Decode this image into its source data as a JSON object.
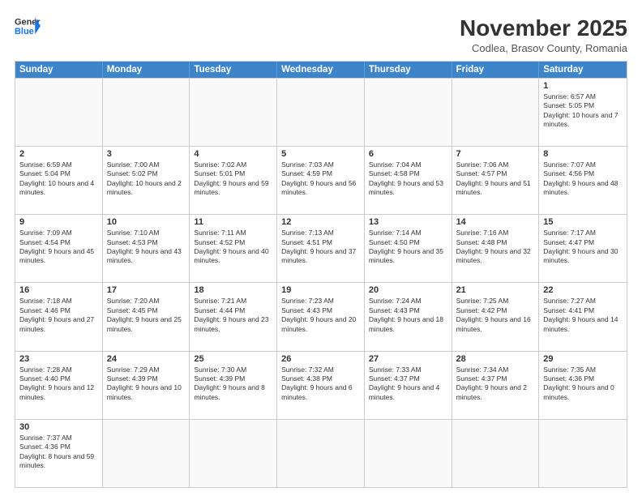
{
  "header": {
    "logo_general": "General",
    "logo_blue": "Blue",
    "month_title": "November 2025",
    "subtitle": "Codlea, Brasov County, Romania"
  },
  "days_of_week": [
    "Sunday",
    "Monday",
    "Tuesday",
    "Wednesday",
    "Thursday",
    "Friday",
    "Saturday"
  ],
  "weeks": [
    [
      {
        "day": "",
        "info": ""
      },
      {
        "day": "",
        "info": ""
      },
      {
        "day": "",
        "info": ""
      },
      {
        "day": "",
        "info": ""
      },
      {
        "day": "",
        "info": ""
      },
      {
        "day": "",
        "info": ""
      },
      {
        "day": "1",
        "info": "Sunrise: 6:57 AM\nSunset: 5:05 PM\nDaylight: 10 hours and 7 minutes."
      }
    ],
    [
      {
        "day": "2",
        "info": "Sunrise: 6:59 AM\nSunset: 5:04 PM\nDaylight: 10 hours and 4 minutes."
      },
      {
        "day": "3",
        "info": "Sunrise: 7:00 AM\nSunset: 5:02 PM\nDaylight: 10 hours and 2 minutes."
      },
      {
        "day": "4",
        "info": "Sunrise: 7:02 AM\nSunset: 5:01 PM\nDaylight: 9 hours and 59 minutes."
      },
      {
        "day": "5",
        "info": "Sunrise: 7:03 AM\nSunset: 4:59 PM\nDaylight: 9 hours and 56 minutes."
      },
      {
        "day": "6",
        "info": "Sunrise: 7:04 AM\nSunset: 4:58 PM\nDaylight: 9 hours and 53 minutes."
      },
      {
        "day": "7",
        "info": "Sunrise: 7:06 AM\nSunset: 4:57 PM\nDaylight: 9 hours and 51 minutes."
      },
      {
        "day": "8",
        "info": "Sunrise: 7:07 AM\nSunset: 4:56 PM\nDaylight: 9 hours and 48 minutes."
      }
    ],
    [
      {
        "day": "9",
        "info": "Sunrise: 7:09 AM\nSunset: 4:54 PM\nDaylight: 9 hours and 45 minutes."
      },
      {
        "day": "10",
        "info": "Sunrise: 7:10 AM\nSunset: 4:53 PM\nDaylight: 9 hours and 43 minutes."
      },
      {
        "day": "11",
        "info": "Sunrise: 7:11 AM\nSunset: 4:52 PM\nDaylight: 9 hours and 40 minutes."
      },
      {
        "day": "12",
        "info": "Sunrise: 7:13 AM\nSunset: 4:51 PM\nDaylight: 9 hours and 37 minutes."
      },
      {
        "day": "13",
        "info": "Sunrise: 7:14 AM\nSunset: 4:50 PM\nDaylight: 9 hours and 35 minutes."
      },
      {
        "day": "14",
        "info": "Sunrise: 7:16 AM\nSunset: 4:48 PM\nDaylight: 9 hours and 32 minutes."
      },
      {
        "day": "15",
        "info": "Sunrise: 7:17 AM\nSunset: 4:47 PM\nDaylight: 9 hours and 30 minutes."
      }
    ],
    [
      {
        "day": "16",
        "info": "Sunrise: 7:18 AM\nSunset: 4:46 PM\nDaylight: 9 hours and 27 minutes."
      },
      {
        "day": "17",
        "info": "Sunrise: 7:20 AM\nSunset: 4:45 PM\nDaylight: 9 hours and 25 minutes."
      },
      {
        "day": "18",
        "info": "Sunrise: 7:21 AM\nSunset: 4:44 PM\nDaylight: 9 hours and 23 minutes."
      },
      {
        "day": "19",
        "info": "Sunrise: 7:23 AM\nSunset: 4:43 PM\nDaylight: 9 hours and 20 minutes."
      },
      {
        "day": "20",
        "info": "Sunrise: 7:24 AM\nSunset: 4:43 PM\nDaylight: 9 hours and 18 minutes."
      },
      {
        "day": "21",
        "info": "Sunrise: 7:25 AM\nSunset: 4:42 PM\nDaylight: 9 hours and 16 minutes."
      },
      {
        "day": "22",
        "info": "Sunrise: 7:27 AM\nSunset: 4:41 PM\nDaylight: 9 hours and 14 minutes."
      }
    ],
    [
      {
        "day": "23",
        "info": "Sunrise: 7:28 AM\nSunset: 4:40 PM\nDaylight: 9 hours and 12 minutes."
      },
      {
        "day": "24",
        "info": "Sunrise: 7:29 AM\nSunset: 4:39 PM\nDaylight: 9 hours and 10 minutes."
      },
      {
        "day": "25",
        "info": "Sunrise: 7:30 AM\nSunset: 4:39 PM\nDaylight: 9 hours and 8 minutes."
      },
      {
        "day": "26",
        "info": "Sunrise: 7:32 AM\nSunset: 4:38 PM\nDaylight: 9 hours and 6 minutes."
      },
      {
        "day": "27",
        "info": "Sunrise: 7:33 AM\nSunset: 4:37 PM\nDaylight: 9 hours and 4 minutes."
      },
      {
        "day": "28",
        "info": "Sunrise: 7:34 AM\nSunset: 4:37 PM\nDaylight: 9 hours and 2 minutes."
      },
      {
        "day": "29",
        "info": "Sunrise: 7:35 AM\nSunset: 4:36 PM\nDaylight: 9 hours and 0 minutes."
      }
    ],
    [
      {
        "day": "30",
        "info": "Sunrise: 7:37 AM\nSunset: 4:36 PM\nDaylight: 8 hours and 59 minutes."
      },
      {
        "day": "",
        "info": ""
      },
      {
        "day": "",
        "info": ""
      },
      {
        "day": "",
        "info": ""
      },
      {
        "day": "",
        "info": ""
      },
      {
        "day": "",
        "info": ""
      },
      {
        "day": "",
        "info": ""
      }
    ]
  ]
}
